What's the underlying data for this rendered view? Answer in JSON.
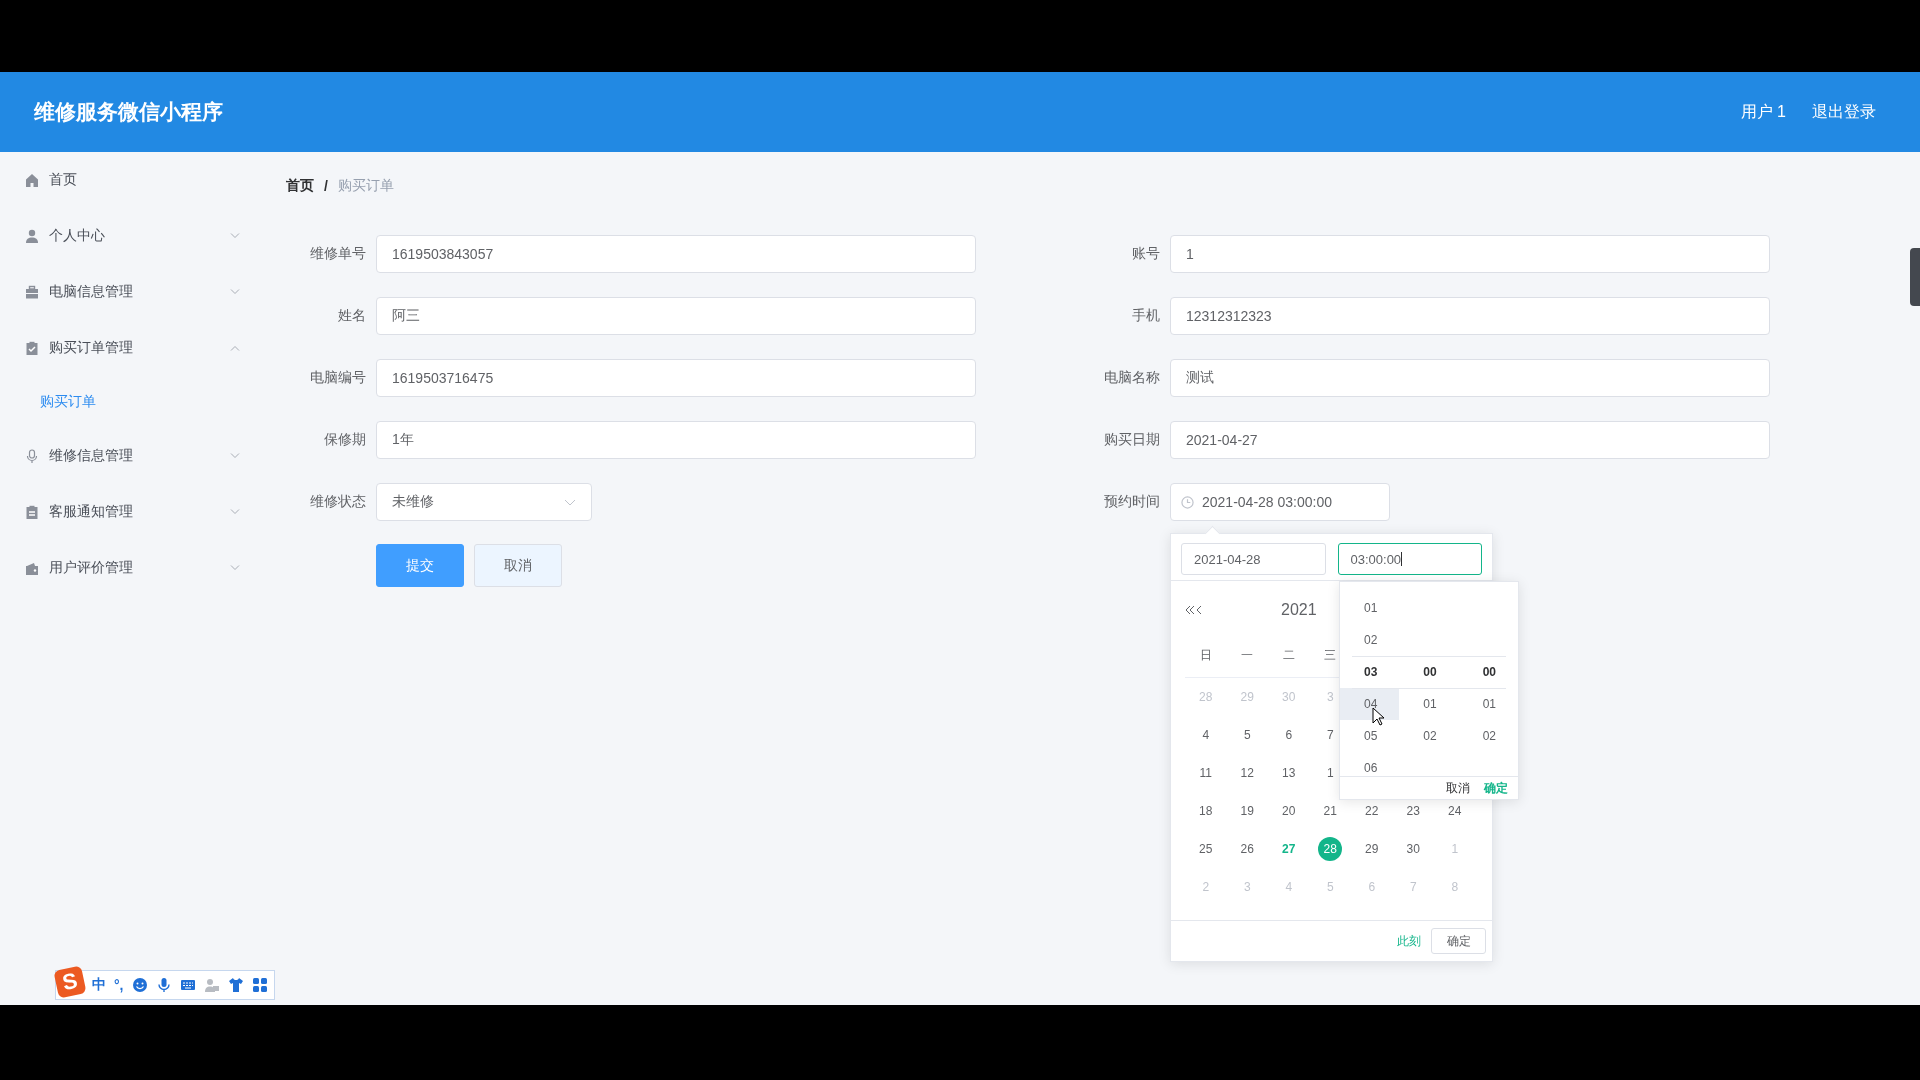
{
  "header": {
    "title": "维修服务微信小程序",
    "user": "用户 1",
    "logout": "退出登录"
  },
  "sidebar": {
    "items": [
      {
        "label": "首页",
        "kind": "link"
      },
      {
        "label": "个人中心",
        "kind": "submenu",
        "expanded": false
      },
      {
        "label": "电脑信息管理",
        "kind": "submenu",
        "expanded": false
      },
      {
        "label": "购买订单管理",
        "kind": "submenu",
        "expanded": true,
        "children": [
          {
            "label": "购买订单",
            "selected": true
          }
        ]
      },
      {
        "label": "维修信息管理",
        "kind": "submenu",
        "expanded": false
      },
      {
        "label": "客服通知管理",
        "kind": "submenu",
        "expanded": false
      },
      {
        "label": "用户评价管理",
        "kind": "submenu",
        "expanded": false
      }
    ]
  },
  "breadcrumb": {
    "separator": "/",
    "items": [
      {
        "label": "首页",
        "current": false
      },
      {
        "label": "购买订单",
        "current": true
      }
    ]
  },
  "form": {
    "left": [
      {
        "label": "维修单号",
        "value": "1619503843057",
        "kind": "text"
      },
      {
        "label": "姓名",
        "value": "阿三",
        "kind": "text"
      },
      {
        "label": "电脑编号",
        "value": "1619503716475",
        "kind": "text"
      },
      {
        "label": "保修期",
        "value": "1年",
        "kind": "text"
      },
      {
        "label": "维修状态",
        "value": "未维修",
        "kind": "select"
      }
    ],
    "right": [
      {
        "label": "账号",
        "value": "1",
        "kind": "text"
      },
      {
        "label": "手机",
        "value": "12312312323",
        "kind": "text"
      },
      {
        "label": "电脑名称",
        "value": "测试",
        "kind": "text"
      },
      {
        "label": "购买日期",
        "value": "2021-04-27",
        "kind": "text"
      },
      {
        "label": "预约时间",
        "value": "2021-04-28 03:00:00",
        "kind": "datetime"
      }
    ],
    "buttons": [
      {
        "label": "提交",
        "kind": "primary"
      },
      {
        "label": "取消",
        "kind": "default"
      }
    ]
  },
  "date_picker": {
    "date_value": "2021-04-28",
    "time_value": "03:00:00",
    "month_header": "2021",
    "weekdays": [
      "日",
      "一",
      "二",
      "三"
    ],
    "weeks": [
      [
        {
          "d": "28",
          "kind": "muted",
          "selected": false
        },
        {
          "d": "29",
          "kind": "muted",
          "selected": false
        },
        {
          "d": "30",
          "kind": "muted",
          "selected": false
        },
        {
          "d": "3",
          "kind": "muted",
          "selected": false
        }
      ],
      [
        {
          "d": "4",
          "kind": "normal",
          "selected": false
        },
        {
          "d": "5",
          "kind": "normal",
          "selected": false
        },
        {
          "d": "6",
          "kind": "normal",
          "selected": false
        },
        {
          "d": "7",
          "kind": "normal",
          "selected": false
        }
      ],
      [
        {
          "d": "11",
          "kind": "normal",
          "selected": false
        },
        {
          "d": "12",
          "kind": "normal",
          "selected": false
        },
        {
          "d": "13",
          "kind": "normal",
          "selected": false
        },
        {
          "d": "1",
          "kind": "normal",
          "selected": false
        }
      ],
      [
        {
          "d": "18",
          "kind": "normal",
          "selected": false
        },
        {
          "d": "19",
          "kind": "normal",
          "selected": false
        },
        {
          "d": "20",
          "kind": "normal",
          "selected": false
        },
        {
          "d": "21",
          "kind": "normal",
          "selected": false
        },
        {
          "d": "22",
          "kind": "normal",
          "selected": false
        },
        {
          "d": "23",
          "kind": "normal",
          "selected": false
        },
        {
          "d": "24",
          "kind": "normal",
          "selected": false
        }
      ],
      [
        {
          "d": "25",
          "kind": "normal",
          "selected": false
        },
        {
          "d": "26",
          "kind": "normal",
          "selected": false
        },
        {
          "d": "27",
          "kind": "today",
          "selected": false
        },
        {
          "d": "28",
          "kind": "normal",
          "selected": true
        },
        {
          "d": "29",
          "kind": "normal",
          "selected": false
        },
        {
          "d": "30",
          "kind": "normal",
          "selected": false
        },
        {
          "d": "1",
          "kind": "muted",
          "selected": false
        }
      ],
      [
        {
          "d": "2",
          "kind": "muted",
          "selected": false
        },
        {
          "d": "3",
          "kind": "muted",
          "selected": false
        },
        {
          "d": "4",
          "kind": "muted",
          "selected": false
        },
        {
          "d": "5",
          "kind": "muted",
          "selected": false
        },
        {
          "d": "6",
          "kind": "muted",
          "selected": false
        },
        {
          "d": "7",
          "kind": "muted",
          "selected": false
        },
        {
          "d": "8",
          "kind": "muted",
          "selected": false
        }
      ]
    ],
    "now": "此刻",
    "ok": "确定",
    "time_panel": {
      "columns": [
        {
          "items": [
            {
              "label": "01",
              "selected": false,
              "hovered": false
            },
            {
              "label": "02",
              "selected": false,
              "hovered": false
            },
            {
              "label": "03",
              "selected": true,
              "hovered": false
            },
            {
              "label": "04",
              "selected": false,
              "hovered": true
            },
            {
              "label": "05",
              "selected": false,
              "hovered": false
            },
            {
              "label": "06",
              "selected": false,
              "hovered": false
            }
          ]
        },
        {
          "items": [
            {
              "label": "00",
              "selected": true,
              "hovered": false
            },
            {
              "label": "01",
              "selected": false,
              "hovered": false
            },
            {
              "label": "02",
              "selected": false,
              "hovered": false
            }
          ]
        },
        {
          "items": [
            {
              "label": "00",
              "selected": true,
              "hovered": false
            },
            {
              "label": "01",
              "selected": false,
              "hovered": false
            },
            {
              "label": "02",
              "selected": false,
              "hovered": false
            }
          ]
        }
      ],
      "cancel": "取消",
      "ok": "确定"
    }
  },
  "ime_toolbar": {
    "logo": "S",
    "mode": "中",
    "punct": "°,"
  }
}
